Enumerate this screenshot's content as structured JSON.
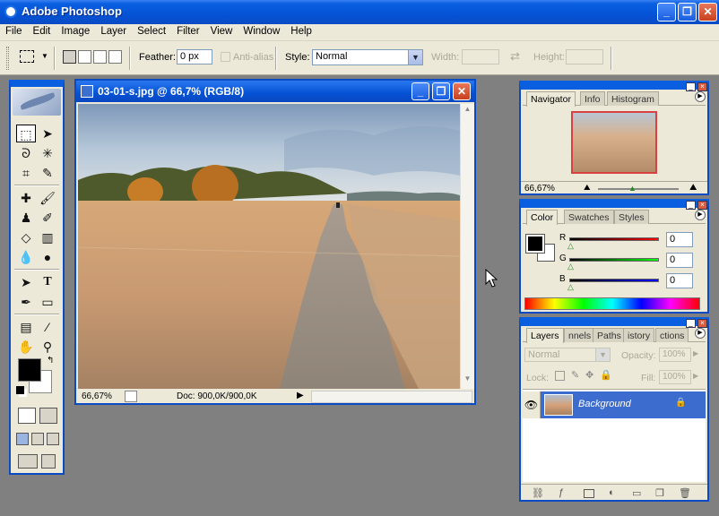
{
  "window": {
    "title": "Adobe Photoshop",
    "minimize": "_",
    "maximize": "❐",
    "close": "✕"
  },
  "menu": [
    "File",
    "Edit",
    "Image",
    "Layer",
    "Select",
    "Filter",
    "View",
    "Window",
    "Help"
  ],
  "options": {
    "feather_label": "Feather:",
    "feather_value": "0 px",
    "antialias_label": "Anti-alias",
    "style_label": "Style:",
    "style_value": "Normal",
    "width_label": "Width:",
    "height_label": "Height:"
  },
  "document": {
    "title": "03-01-s.jpg @ 66,7% (RGB/8)",
    "zoom": "66,67%",
    "doc_info": "Doc: 900,0K/900,0K"
  },
  "navigator": {
    "tabs": [
      "Navigator",
      "Info",
      "Histogram"
    ],
    "zoom": "66,67%"
  },
  "color": {
    "tabs": [
      "Color",
      "Swatches",
      "Styles"
    ],
    "channels": [
      {
        "label": "R",
        "value": "0",
        "color": "#cc2222"
      },
      {
        "label": "G",
        "value": "0",
        "color": "#22aa22"
      },
      {
        "label": "B",
        "value": "0",
        "color": "#2244cc"
      }
    ]
  },
  "layers": {
    "tabs": [
      "Layers",
      "nnels",
      "Paths",
      "istory",
      "ctions"
    ],
    "blend_mode": "Normal",
    "opacity_label": "Opacity:",
    "opacity_value": "100%",
    "lock_label": "Lock:",
    "fill_label": "Fill:",
    "fill_value": "100%",
    "items": [
      {
        "name": "Background"
      }
    ]
  },
  "colors": {
    "xp_blue": "#0a5fe0",
    "layer_selected": "#3d6ccf"
  }
}
